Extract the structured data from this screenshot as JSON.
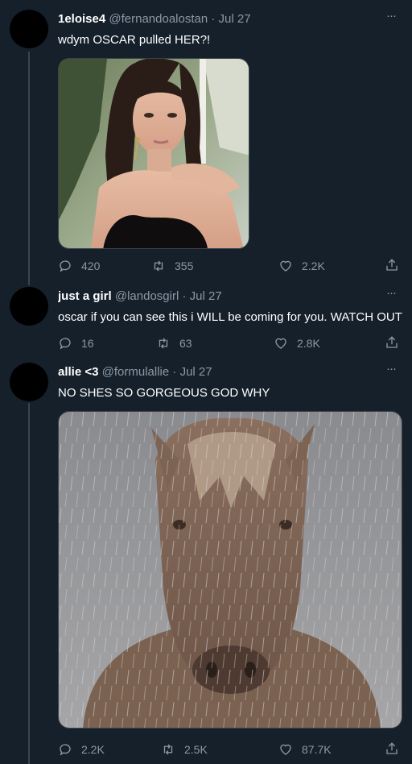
{
  "tweets": [
    {
      "name": "1eloise4",
      "handle": "@fernandoalostan",
      "date": "Jul 27",
      "text": "wdym OSCAR pulled HER?!",
      "image": "photo of a young woman with long dark hair in a black strapless top",
      "replies": "420",
      "retweets": "355",
      "likes": "2.2K"
    },
    {
      "name": "just a girl",
      "handle": "@landosgirl",
      "date": "Jul 27",
      "text": "oscar if you can see this i WILL be coming for you. WATCH OUT",
      "replies": "16",
      "retweets": "63",
      "likes": "2.8K"
    },
    {
      "name": "allie <3",
      "handle": "@formulallie",
      "date": "Jul 27",
      "text": "NO SHES SO GORGEOUS GOD WHY",
      "image": "horse standing in the rain",
      "replies": "2.2K",
      "retweets": "2.5K",
      "likes": "87.7K"
    }
  ],
  "separator": "·",
  "more_label": "···",
  "icons": {
    "reply": "reply-icon",
    "retweet": "retweet-icon",
    "like": "like-icon",
    "share": "share-icon",
    "more": "more-icon"
  },
  "colors": {
    "background": "#15202b",
    "text": "#ffffff",
    "secondary": "#8b98a5",
    "border": "#38444d"
  }
}
